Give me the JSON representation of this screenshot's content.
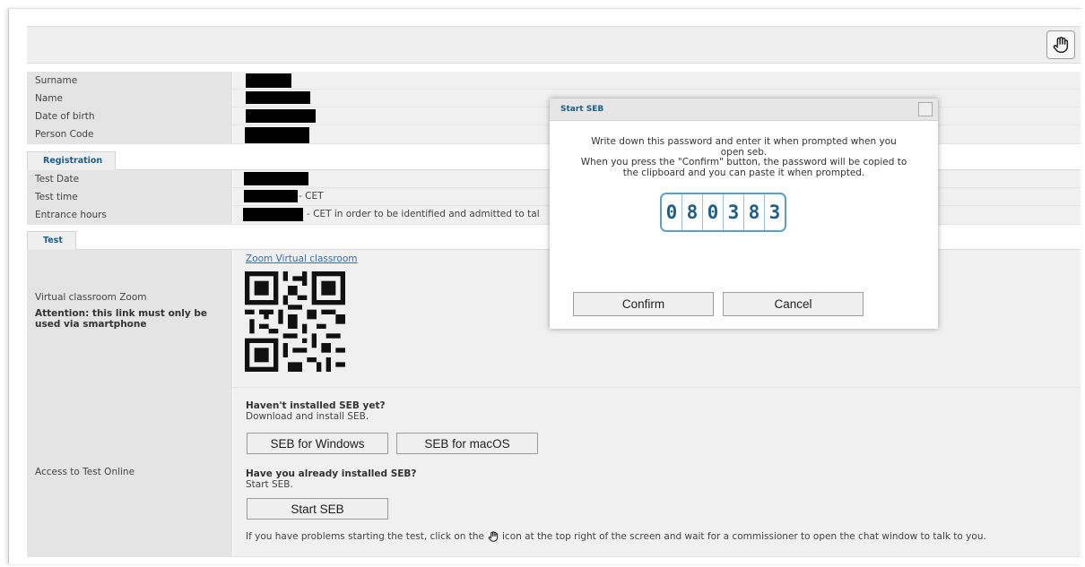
{
  "form": {
    "fields": [
      {
        "label": "Surname"
      },
      {
        "label": "Name"
      },
      {
        "label": "Date of birth"
      },
      {
        "label": "Person Code"
      }
    ],
    "registration_tab": "Registration",
    "registration": {
      "test_date_label": "Test Date",
      "test_time_label": "Test time",
      "test_time_suffix": "- CET",
      "entrance_label": "Entrance hours",
      "entrance_suffix": "- CET in order to be identified and admitted to tal"
    },
    "test_tab": "Test",
    "virtual": {
      "label": "Virtual classroom Zoom",
      "attention": "Attention: this link must only be used via smartphone",
      "link": "Zoom Virtual classroom"
    },
    "access": {
      "label": "Access to Test Online",
      "not_installed_title": "Haven't installed SEB yet?",
      "not_installed_text": "Download and install SEB.",
      "btn_windows": "SEB for Windows",
      "btn_macos": "SEB for macOS",
      "installed_title": "Have you already installed SEB?",
      "installed_text": "Start SEB.",
      "btn_start": "Start SEB",
      "help_before": "If you have problems starting the test, click on the",
      "help_after": "icon at the top right of the screen and wait for a commissioner to open the chat window to talk to you."
    }
  },
  "toolbar": {
    "hand_icon": "hand-icon"
  },
  "dialog": {
    "title": "Start SEB",
    "message_line1": "Write down this password and enter it when prompted when you",
    "message_line2": "open seb.",
    "message_line3": "When you press the \"Confirm\" button, the password will be copied to",
    "message_line4": "the clipboard and you can paste it when prompted.",
    "password_digits": [
      "0",
      "8",
      "0",
      "3",
      "8",
      "3"
    ],
    "confirm": "Confirm",
    "cancel": "Cancel"
  },
  "colors": {
    "accent": "#1a5f8e",
    "password_border": "#5aa0c8",
    "redaction": "#000000"
  }
}
